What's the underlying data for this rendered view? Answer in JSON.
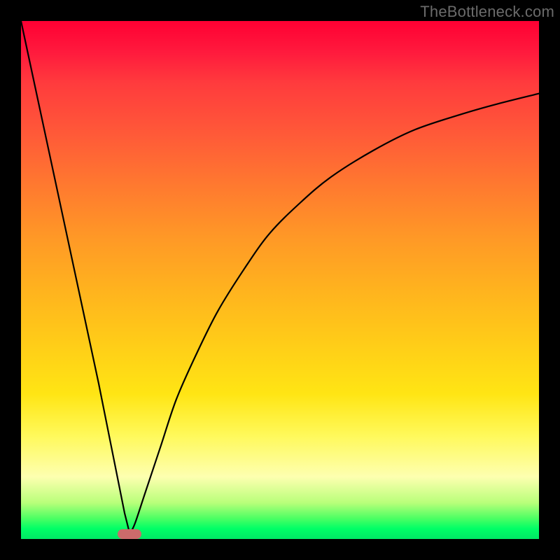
{
  "watermark": "TheBottleneck.com",
  "colors": {
    "frame": "#000000",
    "gradient_top": "#ff0033",
    "gradient_mid1": "#ff9926",
    "gradient_mid2": "#ffe514",
    "gradient_bottom": "#00e865",
    "curve": "#000000",
    "marker": "#cc6b6b"
  },
  "chart_data": {
    "type": "line",
    "title": "",
    "xlabel": "",
    "ylabel": "",
    "xlim": [
      0,
      100
    ],
    "ylim": [
      0,
      100
    ],
    "grid": false,
    "note": "Background heat gradient encodes score (green=good near 0, red=bad near 100). Curve shows bottleneck % vs x; sharp V minimum near x≈21. Marker flags the optimum.",
    "series": [
      {
        "name": "bottleneck-curve",
        "x": [
          0,
          3,
          6,
          9,
          12,
          15,
          18,
          20,
          21,
          22,
          24,
          27,
          30,
          34,
          38,
          43,
          48,
          54,
          60,
          68,
          76,
          85,
          92,
          100
        ],
        "y": [
          100,
          86,
          72,
          58,
          44,
          30,
          15,
          5,
          1,
          3,
          9,
          18,
          27,
          36,
          44,
          52,
          59,
          65,
          70,
          75,
          79,
          82,
          84,
          86
        ]
      }
    ],
    "marker": {
      "x": 21,
      "y": 1
    }
  }
}
